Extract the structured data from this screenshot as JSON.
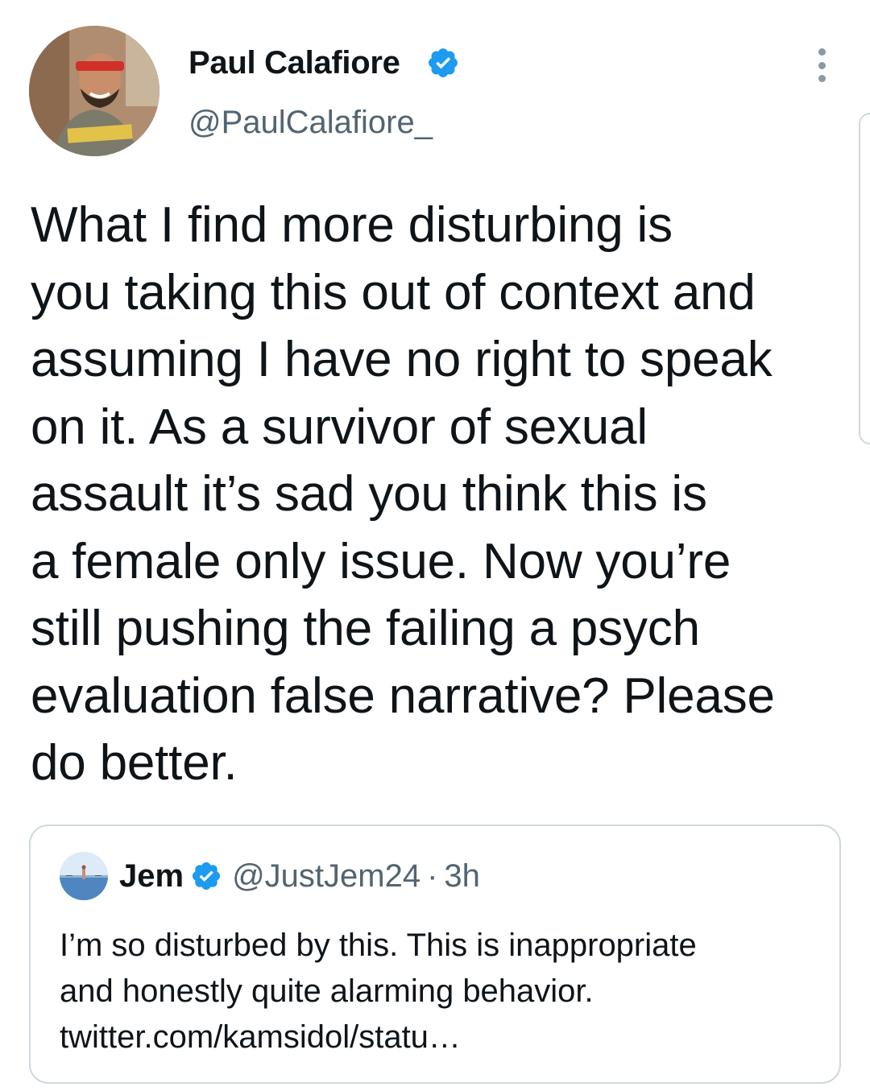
{
  "tweet": {
    "author": {
      "name": "Paul Calafiore",
      "handle": "@PaulCalafiore_",
      "verified": true,
      "avatar_icon": "profile-photo"
    },
    "menu_icon": "more-vertical-icon",
    "text": "What I find more disturbing is\nyou taking this out of context and\nassuming I have no right to speak\non it. As a survivor of sexual\nassault it’s sad you think this is\na female only issue. Now you’re\nstill pushing the failing a psych\nevaluation false narrative? Please\ndo better.",
    "quoted": {
      "name": "Jem",
      "handle": "@JustJem24",
      "separator": "·",
      "time": "3h",
      "verified": true,
      "text": "I’m so disturbed by this. This is inappropriate\nand honestly quite alarming behavior.\ntwitter.com/kamsidol/statu…"
    }
  },
  "colors": {
    "text_primary": "#0f1419",
    "text_secondary": "#536471",
    "verified_blue": "#1d9bf0",
    "border": "#cfd9de"
  }
}
